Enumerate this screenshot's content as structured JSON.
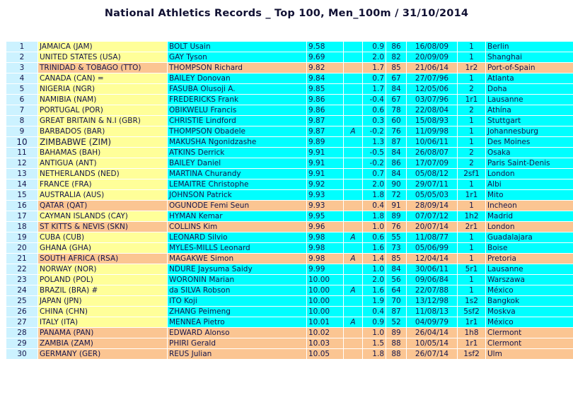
{
  "title": "National Athletics Records _ Top 100, Men_100m / 31/10/2014",
  "colors": {
    "cyan": "#00ffff",
    "yellow": "#ffff99",
    "peach": "#fbc592",
    "rank_cell": "#ccf2ff",
    "text": "#14144a",
    "page_background": "#ffffff"
  },
  "columns": [
    "rank",
    "nation",
    "athlete",
    "time",
    "altitude",
    "wind",
    "born",
    "date",
    "position",
    "venue"
  ],
  "rows": [
    {
      "rank": "1",
      "nation": "JAMAICA (JAM)",
      "athlete": "BOLT Usain",
      "time": "9.58",
      "alt": "",
      "wind": "0.9",
      "born": "86",
      "date": "16/08/09",
      "pos": "1",
      "venue": "Berlin",
      "nation_fill": "yellow",
      "row_fill": "cyan"
    },
    {
      "rank": "2",
      "nation": "UNITED STATES (USA)",
      "athlete": "GAY Tyson",
      "time": "9.69",
      "alt": "",
      "wind": "2.0",
      "born": "82",
      "date": "20/09/09",
      "pos": "1",
      "venue": "Shanghai",
      "nation_fill": "yellow",
      "row_fill": "cyan"
    },
    {
      "rank": "3",
      "nation": "TRINIDAD & TOBAGO (TTO)",
      "athlete": "THOMPSON Richard",
      "time": "9.82",
      "alt": "",
      "wind": "1.7",
      "born": "85",
      "date": "21/06/14",
      "pos": "1r2",
      "venue": "Port-of-Spain",
      "nation_fill": "peach",
      "row_fill": "peach"
    },
    {
      "rank": "4",
      "nation": "CANADA (CAN) =",
      "athlete": "BAILEY Donovan",
      "time": "9.84",
      "alt": "",
      "wind": "0.7",
      "born": "67",
      "date": "27/07/96",
      "pos": "1",
      "venue": "Atlanta",
      "nation_fill": "yellow",
      "row_fill": "cyan"
    },
    {
      "rank": "5",
      "nation": "NIGERIA (NGR)",
      "athlete": "FASUBA Olusoji A.",
      "time": "9.85",
      "alt": "",
      "wind": "1.7",
      "born": "84",
      "date": "12/05/06",
      "pos": "2",
      "venue": "Doha",
      "nation_fill": "yellow",
      "row_fill": "cyan"
    },
    {
      "rank": "6",
      "nation": "NAMIBIA (NAM)",
      "athlete": "FREDERICKS Frank",
      "time": "9.86",
      "alt": "",
      "wind": "-0.4",
      "born": "67",
      "date": "03/07/96",
      "pos": "1r1",
      "venue": "Lausanne",
      "nation_fill": "yellow",
      "row_fill": "cyan"
    },
    {
      "rank": "7",
      "nation": "PORTUGAL (POR)",
      "athlete": "OBIKWELU Francis",
      "time": "9.86",
      "alt": "",
      "wind": "0.6",
      "born": "78",
      "date": "22/08/04",
      "pos": "2",
      "venue": "Athína",
      "nation_fill": "yellow",
      "row_fill": "cyan"
    },
    {
      "rank": "8",
      "nation": "GREAT BRITAIN & N.I (GBR)",
      "athlete": "CHRISTIE Lindford",
      "time": "9.87",
      "alt": "",
      "wind": "0.3",
      "born": "60",
      "date": "15/08/93",
      "pos": "1",
      "venue": "Stuttgart",
      "nation_fill": "yellow",
      "row_fill": "cyan"
    },
    {
      "rank": "9",
      "nation": "BARBADOS (BAR)",
      "athlete": "THOMPSON Obadele",
      "time": "9.87",
      "alt": "A",
      "wind": "-0.2",
      "born": "76",
      "date": "11/09/98",
      "pos": "1",
      "venue": "Johannesburg",
      "nation_fill": "yellow",
      "row_fill": "cyan"
    },
    {
      "rank": "10",
      "nation": "ZIMBABWE (ZIM)",
      "athlete": "MAKUSHA Ngonidzashe",
      "time": "9.89",
      "alt": "",
      "wind": "1.3",
      "born": "87",
      "date": "10/06/11",
      "pos": "1",
      "venue": "Des Moines",
      "nation_fill": "yellow",
      "row_fill": "cyan",
      "emphasis": true
    },
    {
      "rank": "11",
      "nation": "BAHAMAS (BAH)",
      "athlete": "ATKINS Derrick",
      "time": "9.91",
      "alt": "",
      "wind": "-0.5",
      "born": "84",
      "date": "26/08/07",
      "pos": "2",
      "venue": "Osaka",
      "nation_fill": "yellow",
      "row_fill": "cyan"
    },
    {
      "rank": "12",
      "nation": "ANTIGUA (ANT)",
      "athlete": "BAILEY Daniel",
      "time": "9.91",
      "alt": "",
      "wind": "-0.2",
      "born": "86",
      "date": "17/07/09",
      "pos": "2",
      "venue": "Paris Saint-Denis",
      "nation_fill": "yellow",
      "row_fill": "cyan"
    },
    {
      "rank": "13",
      "nation": "NETHERLANDS (NED)",
      "athlete": "MARTINA Churandy",
      "time": "9.91",
      "alt": "",
      "wind": "0.7",
      "born": "84",
      "date": "05/08/12",
      "pos": "2sf1",
      "venue": "London",
      "nation_fill": "yellow",
      "row_fill": "cyan"
    },
    {
      "rank": "14",
      "nation": "FRANCE (FRA)",
      "athlete": "LEMAITRE Christophe",
      "time": "9.92",
      "alt": "",
      "wind": "2.0",
      "born": "90",
      "date": "29/07/11",
      "pos": "1",
      "venue": "Albi",
      "nation_fill": "yellow",
      "row_fill": "cyan"
    },
    {
      "rank": "15",
      "nation": "AUSTRALIA (AUS)",
      "athlete": "JOHNSON Patrick",
      "time": "9.93",
      "alt": "",
      "wind": "1.8",
      "born": "72",
      "date": "05/05/03",
      "pos": "1r1",
      "venue": "Mito",
      "nation_fill": "yellow",
      "row_fill": "cyan"
    },
    {
      "rank": "16",
      "nation": "QATAR  (QAT)",
      "athlete": "OGUNODE Femi Seun",
      "time": "9.93",
      "alt": "",
      "wind": "0.4",
      "born": "91",
      "date": "28/09/14",
      "pos": "1",
      "venue": "Incheon",
      "nation_fill": "peach",
      "row_fill": "peach"
    },
    {
      "rank": "17",
      "nation": "CAYMAN ISLANDS (CAY)",
      "athlete": "HYMAN Kemar",
      "time": "9.95",
      "alt": "",
      "wind": "1.8",
      "born": "89",
      "date": "07/07/12",
      "pos": "1h2",
      "venue": "Madrid",
      "nation_fill": "yellow",
      "row_fill": "cyan"
    },
    {
      "rank": "18",
      "nation": "ST KITTS & NEVIS (SKN)",
      "athlete": "COLLINS Kim",
      "time": "9.96",
      "alt": "",
      "wind": "1.0",
      "born": "76",
      "date": "20/07/14",
      "pos": "2r1",
      "venue": "London",
      "nation_fill": "peach",
      "row_fill": "peach"
    },
    {
      "rank": "19",
      "nation": "CUBA (CUB)",
      "athlete": "LEONARD Silvio",
      "time": "9.98",
      "alt": "A",
      "wind": "0.6",
      "born": "55",
      "date": "11/08/77",
      "pos": "1",
      "venue": "Guadalajara",
      "nation_fill": "yellow",
      "row_fill": "cyan"
    },
    {
      "rank": "20",
      "nation": "GHANA (GHA)",
      "athlete": "MYLES-MILLS Leonard",
      "time": "9.98",
      "alt": "",
      "wind": "1.6",
      "born": "73",
      "date": "05/06/99",
      "pos": "1",
      "venue": "Boise",
      "nation_fill": "yellow",
      "row_fill": "cyan"
    },
    {
      "rank": "21",
      "nation": "SOUTH AFRICA (RSA)",
      "athlete": "MAGAKWE Simon",
      "time": "9.98",
      "alt": "A",
      "wind": "1.4",
      "born": "85",
      "date": "12/04/14",
      "pos": "1",
      "venue": "Pretoria",
      "nation_fill": "peach",
      "row_fill": "peach"
    },
    {
      "rank": "22",
      "nation": "NORWAY (NOR)",
      "athlete": "NDURE Jaysuma Saidy",
      "time": "9.99",
      "alt": "",
      "wind": "1.0",
      "born": "84",
      "date": "30/06/11",
      "pos": "5r1",
      "venue": "Lausanne",
      "nation_fill": "yellow",
      "row_fill": "cyan"
    },
    {
      "rank": "23",
      "nation": "POLAND (POL)",
      "athlete": "WORONIN Marian",
      "time": "10.00",
      "alt": "",
      "wind": "2.0",
      "born": "56",
      "date": "09/06/84",
      "pos": "1",
      "venue": "Warszawa",
      "nation_fill": "yellow",
      "row_fill": "cyan"
    },
    {
      "rank": "24",
      "nation": "BRAZIL (BRA) #",
      "athlete": "da SILVA Robson",
      "time": "10.00",
      "alt": "A",
      "wind": "1.6",
      "born": "64",
      "date": "22/07/88",
      "pos": "1",
      "venue": "México",
      "nation_fill": "yellow",
      "row_fill": "cyan"
    },
    {
      "rank": "25",
      "nation": "JAPAN (JPN)",
      "athlete": "ITO Koji",
      "time": "10.00",
      "alt": "",
      "wind": "1.9",
      "born": "70",
      "date": "13/12/98",
      "pos": "1s2",
      "venue": "Bangkok",
      "nation_fill": "yellow",
      "row_fill": "cyan"
    },
    {
      "rank": "26",
      "nation": "CHINA (CHN)",
      "athlete": "ZHANG Peimeng",
      "time": "10.00",
      "alt": "",
      "wind": "0.4",
      "born": "87",
      "date": "11/08/13",
      "pos": "5sf2",
      "venue": "Moskva",
      "nation_fill": "yellow",
      "row_fill": "cyan"
    },
    {
      "rank": "27",
      "nation": "ITALY (ITA)",
      "athlete": "MENNEA Pietro",
      "time": "10.01",
      "alt": "A",
      "wind": "0.9",
      "born": "52",
      "date": "04/09/79",
      "pos": "1r1",
      "venue": "México",
      "nation_fill": "yellow",
      "row_fill": "cyan"
    },
    {
      "rank": "28",
      "nation": "PANAMA (PAN)",
      "athlete": "EDWARD Alonso",
      "time": "10.02",
      "alt": "",
      "wind": "1.0",
      "born": "89",
      "date": "26/04/14",
      "pos": "1h8",
      "venue": "Clermont",
      "nation_fill": "peach",
      "row_fill": "peach"
    },
    {
      "rank": "29",
      "nation": "ZAMBIA (ZAM)",
      "athlete": "PHIRI Gerald",
      "time": "10.03",
      "alt": "",
      "wind": "1.5",
      "born": "88",
      "date": "10/05/14",
      "pos": "1r1",
      "venue": "Clermont",
      "nation_fill": "peach",
      "row_fill": "peach"
    },
    {
      "rank": "30",
      "nation": "GERMANY (GER)",
      "athlete": "REUS Julian",
      "time": "10.05",
      "alt": "",
      "wind": "1.8",
      "born": "88",
      "date": "26/07/14",
      "pos": "1sf2",
      "venue": "Ulm",
      "nation_fill": "peach",
      "row_fill": "peach"
    }
  ]
}
